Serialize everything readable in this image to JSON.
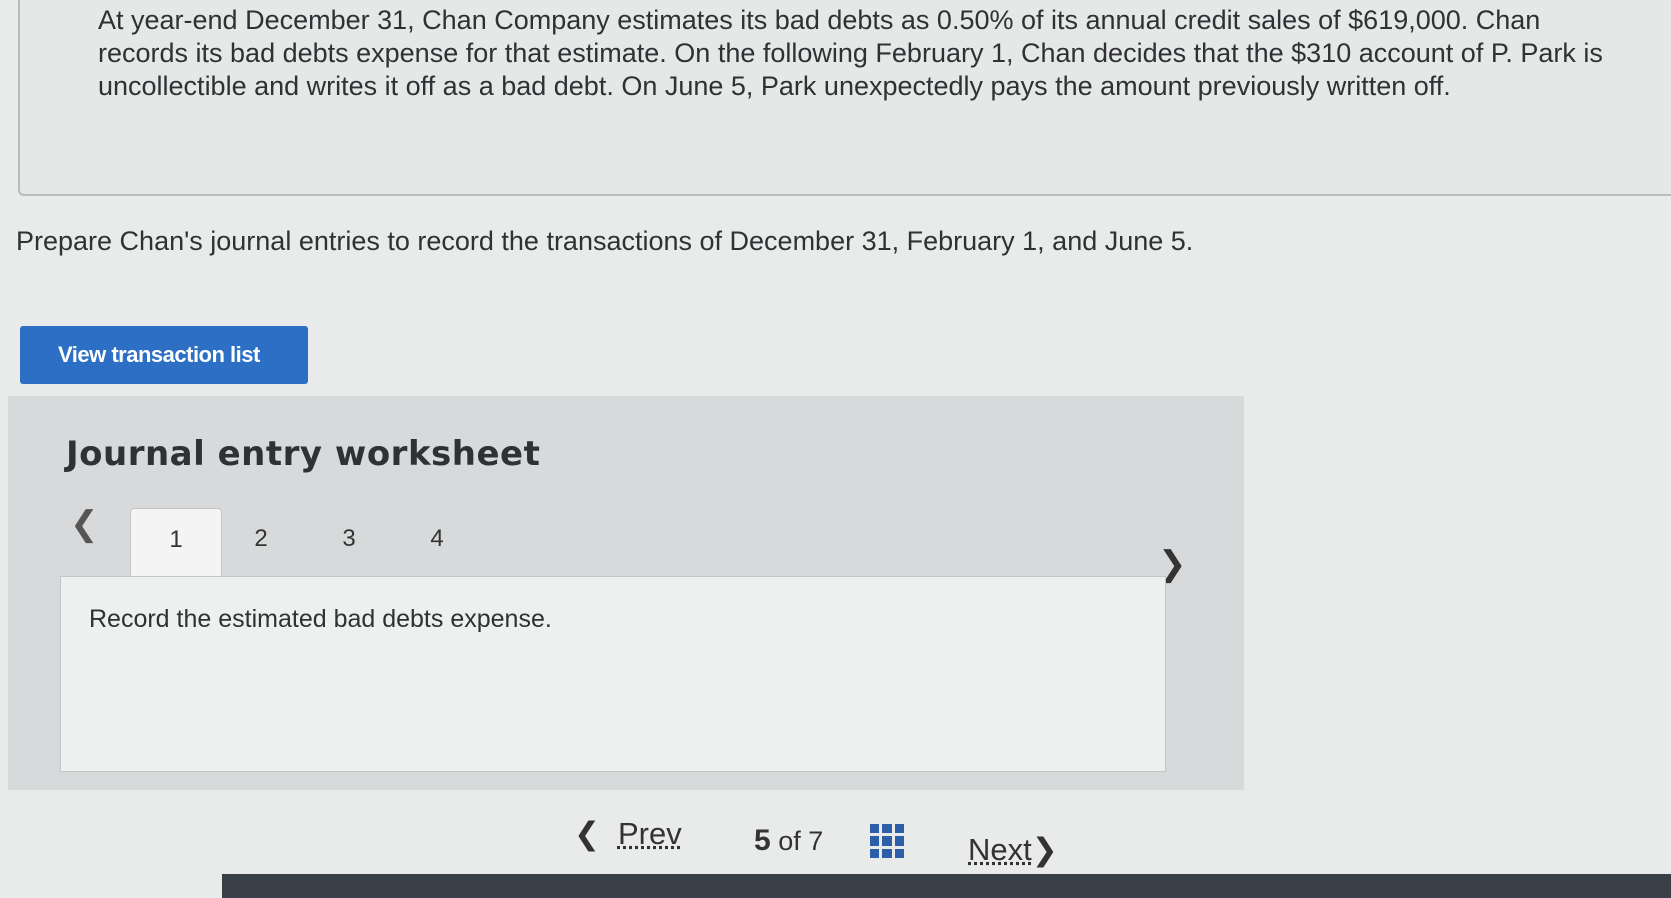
{
  "problem": {
    "text": "At year-end December 31, Chan Company estimates its bad debts as 0.50% of its annual credit sales of $619,000. Chan records its bad debts expense for that estimate. On the following February 1, Chan decides that the $310 account of P. Park is uncollectible and writes it off as a bad debt. On June 5, Park unexpectedly pays the amount previously written off."
  },
  "instruction": "Prepare Chan's journal entries to record the transactions of December 31, February 1, and June 5.",
  "buttons": {
    "view_transactions": "View transaction list"
  },
  "worksheet": {
    "title": "Journal entry worksheet",
    "tabs": [
      "1",
      "2",
      "3",
      "4"
    ],
    "active_tab": "1",
    "panel_text": "Record the estimated bad debts expense."
  },
  "pager": {
    "prev": "Prev",
    "current": "5",
    "of": "of",
    "total": "7",
    "next": "Next"
  },
  "colors": {
    "accent": "#2d6fc4",
    "grid_icon": "#2d5fa8"
  }
}
